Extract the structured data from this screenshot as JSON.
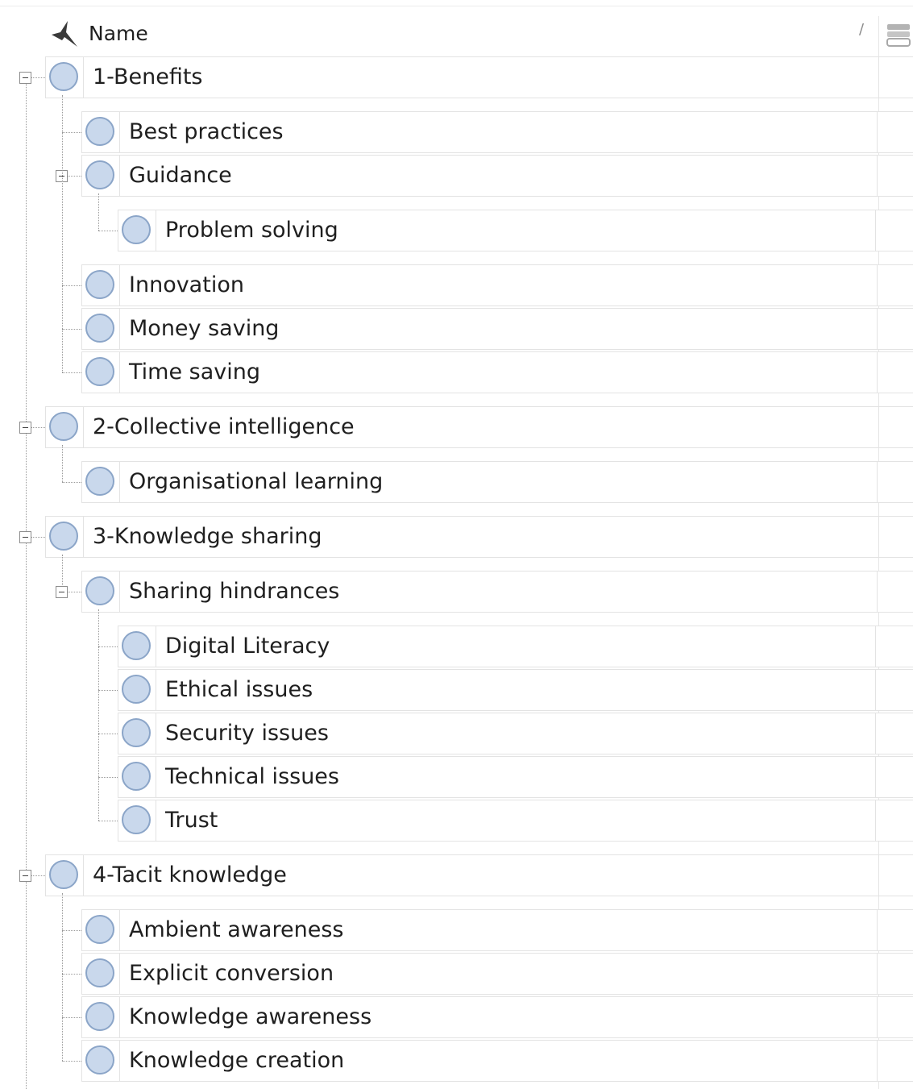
{
  "header": {
    "name_label": "Name",
    "sort_indicator": "/"
  },
  "icons": {
    "header": "codes-star-icon",
    "node": "code-node-circle-icon",
    "column": "references-icon",
    "toggle": "collapse-minus-icon"
  },
  "colors": {
    "node_fill": "#c9d8ec",
    "node_border": "#8ba5c8",
    "row_border": "#e3e3e3"
  },
  "tree": [
    {
      "label": "1-Benefits",
      "level": 0,
      "expanded": true
    },
    {
      "label": "Best practices",
      "level": 1
    },
    {
      "label": "Guidance",
      "level": 1,
      "expanded": true
    },
    {
      "label": "Problem solving",
      "level": 2
    },
    {
      "label": "Innovation",
      "level": 1
    },
    {
      "label": "Money saving",
      "level": 1
    },
    {
      "label": "Time saving",
      "level": 1
    },
    {
      "label": "2-Collective intelligence",
      "level": 0,
      "expanded": true
    },
    {
      "label": "Organisational learning",
      "level": 1
    },
    {
      "label": "3-Knowledge sharing",
      "level": 0,
      "expanded": true
    },
    {
      "label": "Sharing hindrances",
      "level": 1,
      "expanded": true
    },
    {
      "label": "Digital Literacy",
      "level": 2
    },
    {
      "label": "Ethical issues",
      "level": 2
    },
    {
      "label": "Security issues",
      "level": 2
    },
    {
      "label": "Technical issues",
      "level": 2
    },
    {
      "label": "Trust",
      "level": 2
    },
    {
      "label": "4-Tacit knowledge",
      "level": 0,
      "expanded": true
    },
    {
      "label": "Ambient awareness",
      "level": 1
    },
    {
      "label": "Explicit conversion",
      "level": 1
    },
    {
      "label": "Knowledge awareness",
      "level": 1
    },
    {
      "label": "Knowledge creation",
      "level": 1
    }
  ]
}
